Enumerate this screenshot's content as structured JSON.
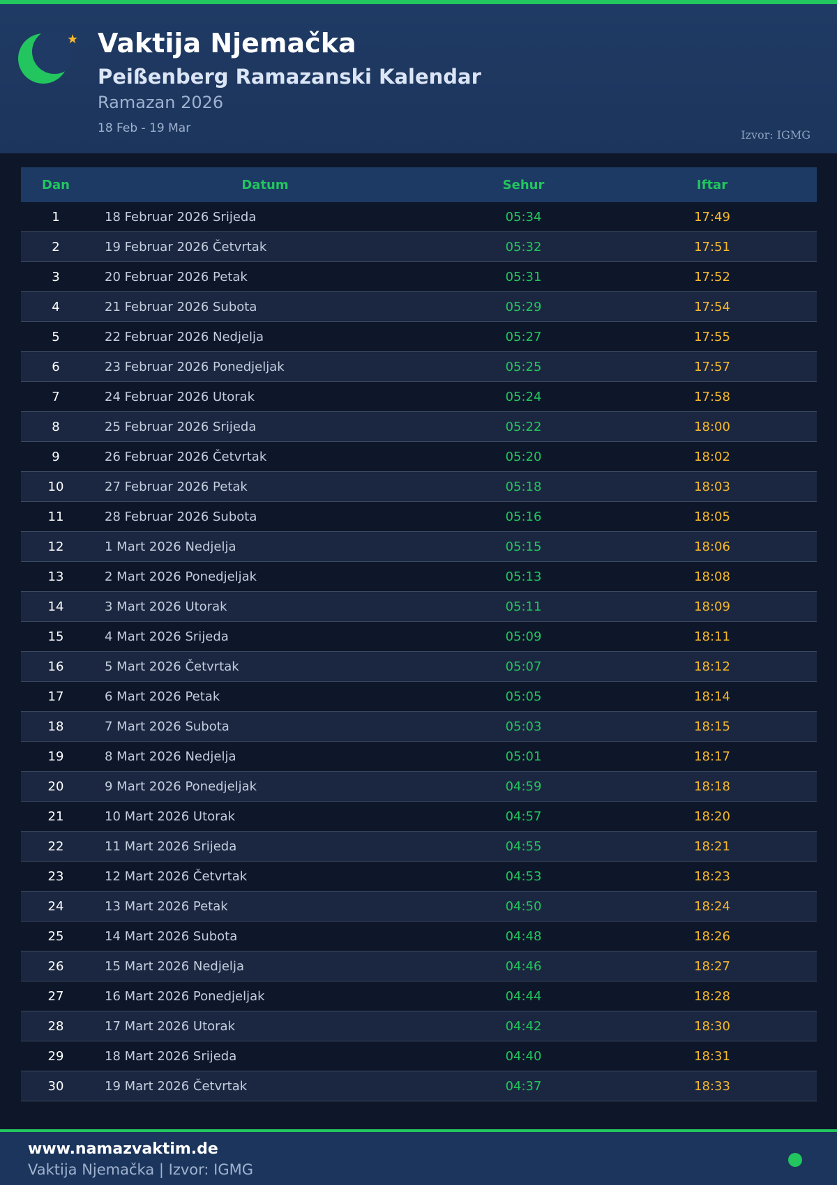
{
  "header": {
    "title": "Vaktija Njemačka",
    "subtitle": "Peißenberg Ramazanski Kalendar",
    "ramadan": "Ramazan 2026",
    "range": "18 Feb - 19 Mar",
    "source": "Izvor: IGMG",
    "icon": "crescent-moon-icon",
    "star_icon": "star-icon"
  },
  "colors": {
    "accent_green": "#22c55e",
    "accent_gold": "#f5b82e",
    "header_bg": "#1f3a64",
    "page_bg": "#0e1729"
  },
  "table": {
    "headers": {
      "dan": "Dan",
      "datum": "Datum",
      "sehur": "Sehur",
      "iftar": "Iftar"
    },
    "rows": [
      {
        "dan": "1",
        "datum": "18 Februar 2026 Srijeda",
        "sehur": "05:34",
        "iftar": "17:49"
      },
      {
        "dan": "2",
        "datum": "19 Februar 2026 Četvrtak",
        "sehur": "05:32",
        "iftar": "17:51"
      },
      {
        "dan": "3",
        "datum": "20 Februar 2026 Petak",
        "sehur": "05:31",
        "iftar": "17:52"
      },
      {
        "dan": "4",
        "datum": "21 Februar 2026 Subota",
        "sehur": "05:29",
        "iftar": "17:54"
      },
      {
        "dan": "5",
        "datum": "22 Februar 2026 Nedjelja",
        "sehur": "05:27",
        "iftar": "17:55"
      },
      {
        "dan": "6",
        "datum": "23 Februar 2026 Ponedjeljak",
        "sehur": "05:25",
        "iftar": "17:57"
      },
      {
        "dan": "7",
        "datum": "24 Februar 2026 Utorak",
        "sehur": "05:24",
        "iftar": "17:58"
      },
      {
        "dan": "8",
        "datum": "25 Februar 2026 Srijeda",
        "sehur": "05:22",
        "iftar": "18:00"
      },
      {
        "dan": "9",
        "datum": "26 Februar 2026 Četvrtak",
        "sehur": "05:20",
        "iftar": "18:02"
      },
      {
        "dan": "10",
        "datum": "27 Februar 2026 Petak",
        "sehur": "05:18",
        "iftar": "18:03"
      },
      {
        "dan": "11",
        "datum": "28 Februar 2026 Subota",
        "sehur": "05:16",
        "iftar": "18:05"
      },
      {
        "dan": "12",
        "datum": "1 Mart 2026 Nedjelja",
        "sehur": "05:15",
        "iftar": "18:06"
      },
      {
        "dan": "13",
        "datum": "2 Mart 2026 Ponedjeljak",
        "sehur": "05:13",
        "iftar": "18:08"
      },
      {
        "dan": "14",
        "datum": "3 Mart 2026 Utorak",
        "sehur": "05:11",
        "iftar": "18:09"
      },
      {
        "dan": "15",
        "datum": "4 Mart 2026 Srijeda",
        "sehur": "05:09",
        "iftar": "18:11"
      },
      {
        "dan": "16",
        "datum": "5 Mart 2026 Četvrtak",
        "sehur": "05:07",
        "iftar": "18:12"
      },
      {
        "dan": "17",
        "datum": "6 Mart 2026 Petak",
        "sehur": "05:05",
        "iftar": "18:14"
      },
      {
        "dan": "18",
        "datum": "7 Mart 2026 Subota",
        "sehur": "05:03",
        "iftar": "18:15"
      },
      {
        "dan": "19",
        "datum": "8 Mart 2026 Nedjelja",
        "sehur": "05:01",
        "iftar": "18:17"
      },
      {
        "dan": "20",
        "datum": "9 Mart 2026 Ponedjeljak",
        "sehur": "04:59",
        "iftar": "18:18"
      },
      {
        "dan": "21",
        "datum": "10 Mart 2026 Utorak",
        "sehur": "04:57",
        "iftar": "18:20"
      },
      {
        "dan": "22",
        "datum": "11 Mart 2026 Srijeda",
        "sehur": "04:55",
        "iftar": "18:21"
      },
      {
        "dan": "23",
        "datum": "12 Mart 2026 Četvrtak",
        "sehur": "04:53",
        "iftar": "18:23"
      },
      {
        "dan": "24",
        "datum": "13 Mart 2026 Petak",
        "sehur": "04:50",
        "iftar": "18:24"
      },
      {
        "dan": "25",
        "datum": "14 Mart 2026 Subota",
        "sehur": "04:48",
        "iftar": "18:26"
      },
      {
        "dan": "26",
        "datum": "15 Mart 2026 Nedjelja",
        "sehur": "04:46",
        "iftar": "18:27"
      },
      {
        "dan": "27",
        "datum": "16 Mart 2026 Ponedjeljak",
        "sehur": "04:44",
        "iftar": "18:28"
      },
      {
        "dan": "28",
        "datum": "17 Mart 2026 Utorak",
        "sehur": "04:42",
        "iftar": "18:30"
      },
      {
        "dan": "29",
        "datum": "18 Mart 2026 Srijeda",
        "sehur": "04:40",
        "iftar": "18:31"
      },
      {
        "dan": "30",
        "datum": "19 Mart 2026 Četvrtak",
        "sehur": "04:37",
        "iftar": "18:33"
      }
    ]
  },
  "footer": {
    "site": "www.namazvaktim.de",
    "line": "Vaktija Njemačka | Izvor: IGMG",
    "dot_icon": "status-dot-icon"
  }
}
